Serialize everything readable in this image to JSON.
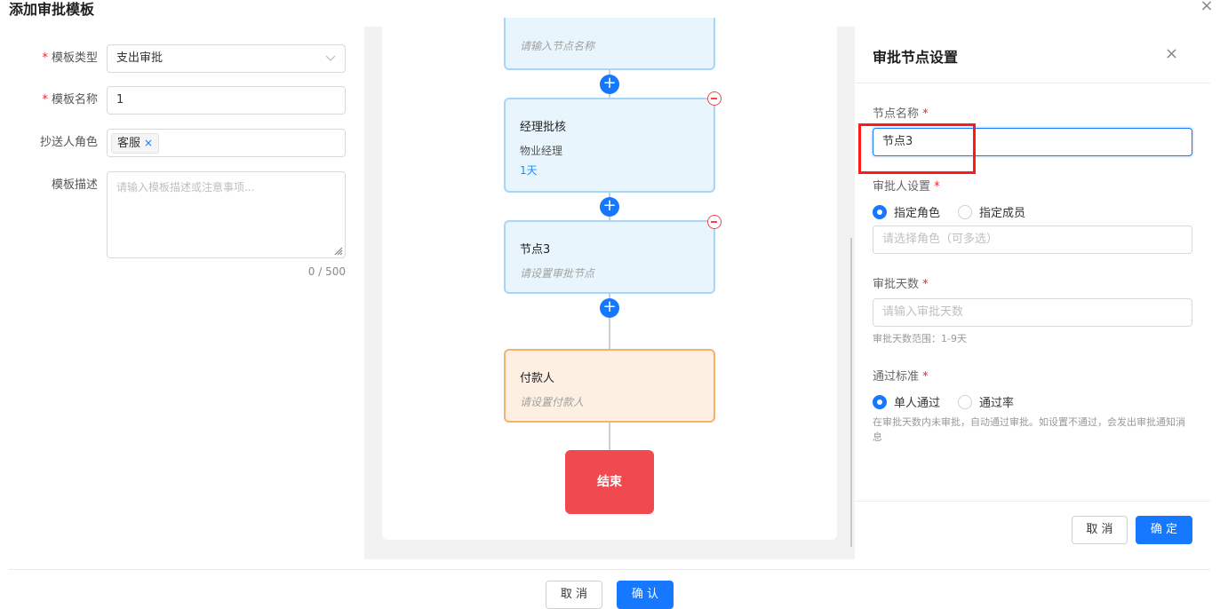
{
  "dialog": {
    "title": "添加审批模板",
    "close_icon": "×"
  },
  "form": {
    "type_label": "模板类型",
    "type_value": "支出审批",
    "name_label": "模板名称",
    "name_value": "1",
    "cc_label": "抄送人角色",
    "cc_tag": "客服",
    "cc_tag_remove": "×",
    "desc_label": "模板描述",
    "desc_placeholder": "请输入模板描述或注意事项...",
    "desc_counter": "0 / 500"
  },
  "flow": {
    "top_node_hint": "请输入节点名称",
    "node2_title": "经理批核",
    "node2_role": "物业经理",
    "node2_days": "1天",
    "node3_title": "节点3",
    "node3_hint": "请设置审批节点",
    "payer_title": "付款人",
    "payer_hint": "请设置付款人",
    "end_label": "结束",
    "plus_glyph": "+"
  },
  "panel": {
    "title": "审批节点设置",
    "close_icon": "×",
    "node_name_label": "节点名称",
    "node_name_value": "节点3",
    "approver_label": "审批人设置",
    "approver_opt_role": "指定角色",
    "approver_opt_member": "指定成员",
    "role_placeholder": "请选择角色（可多选）",
    "days_label": "审批天数",
    "days_placeholder": "请输入审批天数",
    "days_help": "审批天数范围：1-9天",
    "pass_label": "通过标准",
    "pass_opt_single": "单人通过",
    "pass_opt_rate": "通过率",
    "pass_help": "在审批天数内未审批，自动通过审批。如设置不通过，会发出审批通知消息",
    "cancel_label": "取 消",
    "ok_label": "确 定",
    "required_mark": "*"
  },
  "footer": {
    "cancel_label": "取 消",
    "confirm_label": "确 认"
  },
  "colors": {
    "primary": "#1677ff",
    "danger": "#f04a50",
    "highlight": "#ff1a1a"
  }
}
